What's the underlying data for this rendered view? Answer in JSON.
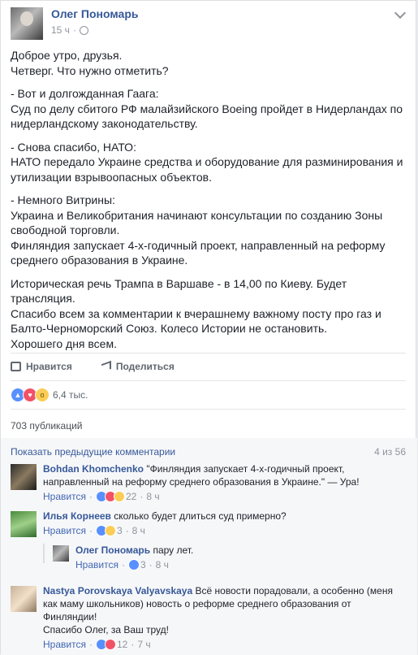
{
  "post": {
    "author": "Олег Пономарь",
    "time": "15 ч",
    "paragraphs": [
      "Доброе утро, друзья.\nЧетверг. Что нужно отметить?",
      "- Вот и долгожданная Гаага:\nСуд по делу сбитого РФ малайзийского Boeing пройдет в Нидерландах по нидерландскому законодательству.",
      "- Снова спасибо, НАТО:\nНАТО передало Украине средства и оборудование для разминирования и утилизации взрывоопасных объектов.",
      "- Немного Витрины:\nУкраина и Великобритания начинают консультации по созданию Зоны свободной торговли.\nФинляндия запускает 4-х-годичный проект, направленный на реформу среднего образования в Украине.",
      "Историческая речь Трампа в Варшаве - в 14,00 по Киеву. Будет трансляция.\nСпасибо всем за комментарии к вчерашнему важному посту про газ и Балто-Черноморский Союз. Колесо Истории не остановить.\nХорошего дня всем."
    ]
  },
  "actions": {
    "like": "Нравится",
    "share": "Поделиться"
  },
  "reactions": {
    "count": "6,4 тыс."
  },
  "publications": "703 публикаций",
  "comments_section": {
    "show_previous": "Показать предыдущие комментарии",
    "page_count": "4 из 56",
    "comments": [
      {
        "name": "Bohdan Khomchenko",
        "text": "\"Финляндия запускает 4-х-годичный проект, направленный на реформу среднего образования в Украине.\" — Ура!",
        "like": "Нравится",
        "reactions": "22",
        "time": "8 ч"
      },
      {
        "name": "Илья Корнеев",
        "text": "сколько будет длиться суд примерно?",
        "like": "Нравится",
        "reactions": "3",
        "time": "8 ч"
      },
      {
        "name": "Олег Пономарь",
        "text": "пару лет.",
        "like": "Нравится",
        "reactions": "3",
        "time": "8 ч"
      },
      {
        "name": "Nastya Porovskaya Valyavskaya",
        "text": "Всё новости порадовали, а особенно (меня как маму школьников) новость о реформе среднего образования от Финляндии!\nСпасибо Олег, за Ваш труд!",
        "like": "Нравится",
        "reactions": "12",
        "time": "7 ч"
      }
    ]
  }
}
